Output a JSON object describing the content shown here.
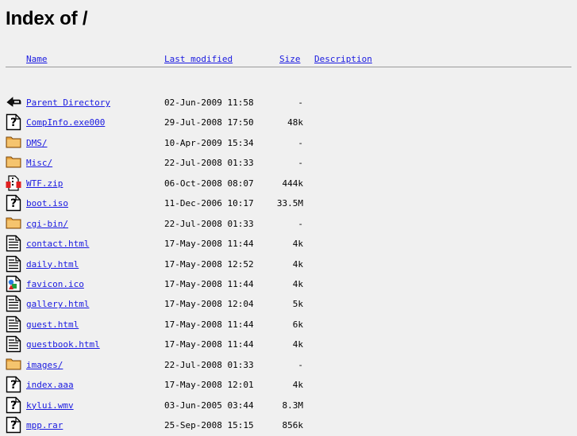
{
  "title": "Index of /",
  "columns": {
    "name": "Name",
    "last_modified": "Last modified",
    "size": "Size",
    "description": "Description"
  },
  "entries": [
    {
      "icon": "back-icon",
      "name": "Parent Directory",
      "modified": "02-Jun-2009 11:58",
      "size": "-"
    },
    {
      "icon": "unknown-file-icon",
      "name": "CompInfo.exe000",
      "modified": "29-Jul-2008 17:50",
      "size": "48k"
    },
    {
      "icon": "folder-icon",
      "name": "DMS/",
      "modified": "10-Apr-2009 15:34",
      "size": "-"
    },
    {
      "icon": "folder-icon",
      "name": "Misc/",
      "modified": "22-Jul-2008 01:33",
      "size": "-"
    },
    {
      "icon": "compressed-file-icon",
      "name": "WTF.zip",
      "modified": "06-Oct-2008 08:07",
      "size": "444k"
    },
    {
      "icon": "unknown-file-icon",
      "name": "boot.iso",
      "modified": "11-Dec-2006 10:17",
      "size": "33.5M"
    },
    {
      "icon": "folder-icon",
      "name": "cgi-bin/",
      "modified": "22-Jul-2008 01:33",
      "size": "-"
    },
    {
      "icon": "text-file-icon",
      "name": "contact.html",
      "modified": "17-May-2008 11:44",
      "size": "4k"
    },
    {
      "icon": "text-file-icon",
      "name": "daily.html",
      "modified": "17-May-2008 12:52",
      "size": "4k"
    },
    {
      "icon": "image-file-icon",
      "name": "favicon.ico",
      "modified": "17-May-2008 11:44",
      "size": "4k"
    },
    {
      "icon": "text-file-icon",
      "name": "gallery.html",
      "modified": "17-May-2008 12:04",
      "size": "5k"
    },
    {
      "icon": "text-file-icon",
      "name": "guest.html",
      "modified": "17-May-2008 11:44",
      "size": "6k"
    },
    {
      "icon": "text-file-icon",
      "name": "guestbook.html",
      "modified": "17-May-2008 11:44",
      "size": "4k"
    },
    {
      "icon": "folder-icon",
      "name": "images/",
      "modified": "22-Jul-2008 01:33",
      "size": "-"
    },
    {
      "icon": "unknown-file-icon",
      "name": "index.aaa",
      "modified": "17-May-2008 12:01",
      "size": "4k"
    },
    {
      "icon": "unknown-file-icon",
      "name": "kylui.wmv",
      "modified": "03-Jun-2005 03:44",
      "size": "8.3M"
    },
    {
      "icon": "unknown-file-icon",
      "name": "mpp.rar",
      "modified": "25-Sep-2008 15:15",
      "size": "856k"
    }
  ]
}
